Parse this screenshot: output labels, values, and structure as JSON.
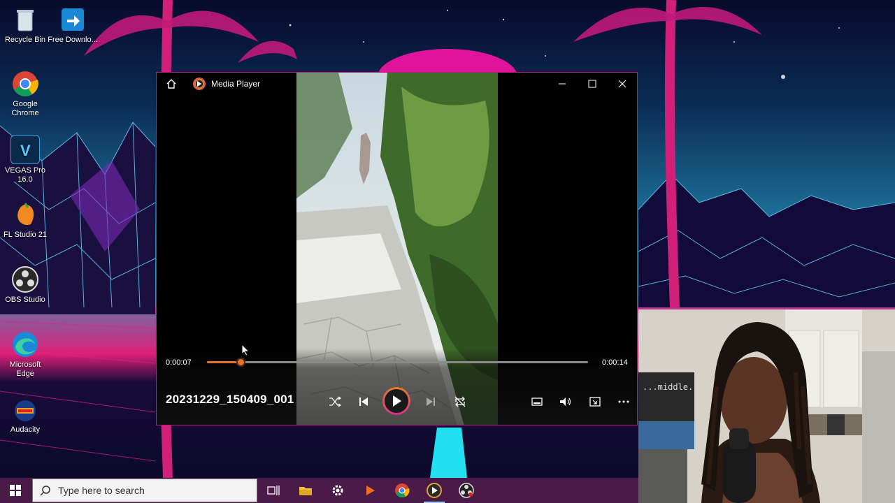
{
  "desktop": {
    "icons": [
      {
        "label": "Recycle Bin",
        "icon": "recycle-bin-icon"
      },
      {
        "label": "Free Downlo...",
        "icon": "free-download-icon"
      },
      {
        "label": "Google Chrome",
        "icon": "chrome-icon"
      },
      {
        "label": "VEGAS Pro 16.0",
        "icon": "vegas-pro-icon"
      },
      {
        "label": "FL Studio 21",
        "icon": "fl-studio-icon"
      },
      {
        "label": "OBS Studio",
        "icon": "obs-icon"
      },
      {
        "label": "Microsoft Edge",
        "icon": "edge-icon"
      },
      {
        "label": "Audacity",
        "icon": "audacity-icon"
      }
    ]
  },
  "player": {
    "title": "Media Player",
    "file_name": "20231229_150409_001",
    "current_time": "0:00:07",
    "total_time": "0:00:14",
    "progress": 0.09,
    "accent_color": "#e8702a"
  },
  "webcam": {
    "sign_text": "...middle."
  },
  "taskbar": {
    "search_placeholder": "Type here to search",
    "pinned": [
      "task-view-icon",
      "file-explorer-icon",
      "settings-icon",
      "vlc-icon",
      "chrome-icon",
      "media-player-icon",
      "obs-icon"
    ]
  }
}
